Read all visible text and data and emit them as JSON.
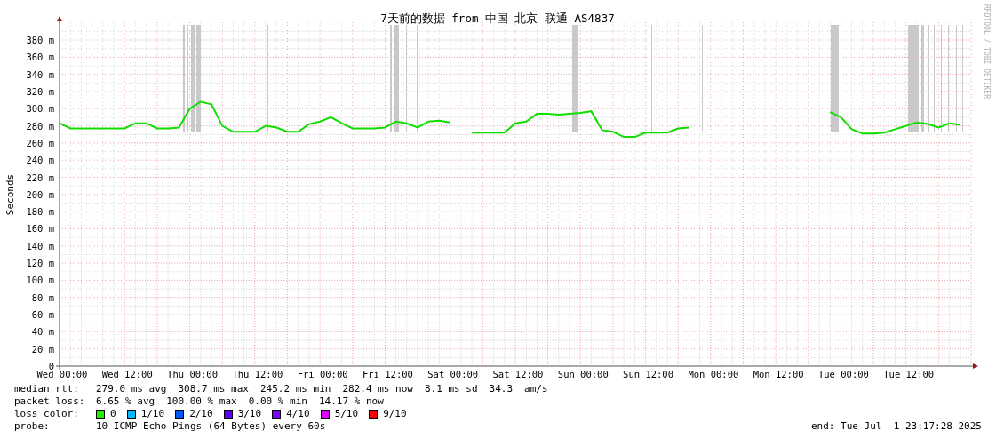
{
  "chart": {
    "credit": "RRDTOOL / TOBI OETIKER",
    "chart_data": {
      "type": "line",
      "title": "7天前的数据 from 中国 北京 联通 AS4837",
      "ylabel": "Seconds",
      "categories": [
        "Wed 00:00",
        null,
        null,
        null,
        null,
        null,
        "Wed 12:00",
        null,
        null,
        null,
        null,
        null,
        "Thu 00:00",
        null,
        null,
        null,
        null,
        null,
        "Thu 12:00",
        null,
        null,
        null,
        null,
        null,
        "Fri 00:00",
        null,
        null,
        null,
        null,
        null,
        "Fri 12:00",
        null,
        null,
        null,
        null,
        null,
        "Sat 00:00",
        null,
        null,
        null,
        null,
        null,
        "Sat 12:00",
        null,
        null,
        null,
        null,
        null,
        "Sun 00:00",
        null,
        null,
        null,
        null,
        null,
        "Sun 12:00",
        null,
        null,
        null,
        null,
        null,
        "Mon 00:00",
        null,
        null,
        null,
        null,
        null,
        "Mon 12:00",
        null,
        null,
        null,
        null,
        null,
        "Tue 00:00",
        null,
        null,
        null,
        null,
        null,
        "Tue 12:00",
        null,
        null,
        null,
        null,
        null
      ],
      "series": [
        {
          "color": "#11dd00",
          "values": [
            283,
            277,
            277,
            277,
            277,
            277,
            277,
            283,
            283,
            277,
            277,
            278,
            300,
            308,
            305,
            280,
            273,
            273,
            273,
            280,
            278,
            273,
            273,
            282,
            285,
            290,
            283,
            277,
            277,
            277,
            278,
            285,
            283,
            278,
            285,
            286,
            284,
            null,
            272,
            272,
            272,
            272,
            283,
            285,
            294,
            294,
            293,
            294,
            295,
            297,
            275,
            273,
            267,
            267,
            272,
            272,
            272,
            277,
            278,
            null,
            null,
            null,
            null,
            null,
            null,
            null,
            null,
            null,
            null,
            null,
            null,
            296,
            290,
            276,
            271,
            271,
            272,
            276,
            280,
            284,
            282,
            278,
            283,
            281
          ]
        }
      ],
      "ylim": [
        0,
        390
      ],
      "grid": true,
      "yticks": [
        {
          "value": 0,
          "label": "0"
        },
        {
          "value": 20,
          "label": "20 m"
        },
        {
          "value": 40,
          "label": "40 m"
        },
        {
          "value": 60,
          "label": "60 m"
        },
        {
          "value": 80,
          "label": "80 m"
        },
        {
          "value": 100,
          "label": "100 m"
        },
        {
          "value": 120,
          "label": "120 m"
        },
        {
          "value": 140,
          "label": "140 m"
        },
        {
          "value": 160,
          "label": "160 m"
        },
        {
          "value": 180,
          "label": "180 m"
        },
        {
          "value": 200,
          "label": "200 m"
        },
        {
          "value": 220,
          "label": "220 m"
        },
        {
          "value": 240,
          "label": "240 m"
        },
        {
          "value": 260,
          "label": "260 m"
        },
        {
          "value": 280,
          "label": "280 m"
        },
        {
          "value": 300,
          "label": "300 m"
        },
        {
          "value": 320,
          "label": "320 m"
        },
        {
          "value": 340,
          "label": "340 m"
        },
        {
          "value": 360,
          "label": "360 m"
        },
        {
          "value": 380,
          "label": "380 m"
        }
      ]
    }
  },
  "legend": [
    {
      "kind": "text",
      "label": "median rtt:",
      "parts": [
        "279.0 ms avg",
        "308.7 ms max",
        "245.2 ms min",
        "282.4 ms now",
        "8.1 ms sd",
        "34.3",
        "am/s"
      ]
    },
    {
      "kind": "text",
      "label": "packet loss:",
      "parts": [
        "6.65 % avg",
        "100.00 % max",
        "0.00 % min",
        "14.17 % now"
      ]
    },
    {
      "kind": "swatches",
      "label": "loss color:",
      "swatches": [
        {
          "label": "0",
          "color": "#22ee00"
        },
        {
          "label": "1/10",
          "color": "#00b8ff"
        },
        {
          "label": "2/10",
          "color": "#0059ff"
        },
        {
          "label": "3/10",
          "color": "#5e00ff"
        },
        {
          "label": "4/10",
          "color": "#7e00ff"
        },
        {
          "label": "5/10",
          "color": "#dd00ff"
        },
        {
          "label": "9/10",
          "color": "#ff0000"
        }
      ]
    },
    {
      "kind": "text",
      "label": "probe:",
      "parts": [
        "10 ICMP Echo Pings (64 Bytes) every 60s"
      ],
      "end": "end: Tue Jul  1 23:17:28 2025"
    }
  ]
}
